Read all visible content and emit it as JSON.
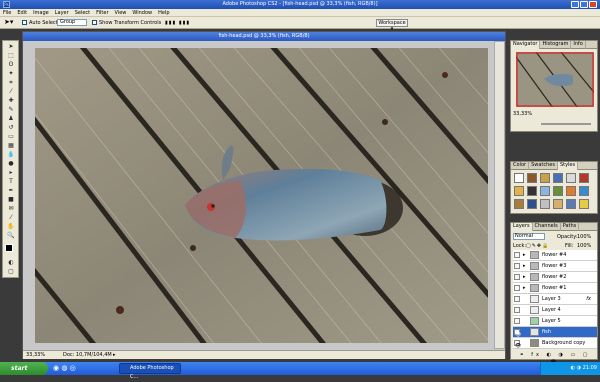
{
  "window": {
    "title": "Adobe Photoshop CS2 - [fish-head.psd @ 33,3% (fish, RGB/8)]"
  },
  "menu": [
    "File",
    "Edit",
    "Image",
    "Layer",
    "Select",
    "Filter",
    "View",
    "Window",
    "Help"
  ],
  "options": {
    "auto_select_label": "Auto Select:",
    "auto_select_value": "Group",
    "transform_label": "Show Transform Controls",
    "workspace_label": "Workspace ▾"
  },
  "document": {
    "title": "fish-head.psd @ 33,3% (fish, RGB/8)",
    "zoom": "33,33%",
    "doc_size": "Doc: 10,7M/104,4M"
  },
  "navigator": {
    "tabs": [
      "Navigator",
      "Histogram",
      "Info"
    ],
    "zoom": "33,33%"
  },
  "color_panel": {
    "tabs": [
      "Color",
      "Swatches",
      "Styles"
    ]
  },
  "layers_panel": {
    "tabs": [
      "Layers",
      "Channels",
      "Paths"
    ],
    "blend_mode": "Normal",
    "opacity_label": "Opacity:",
    "opacity": "100%",
    "lock_label": "Lock:",
    "fill_label": "Fill:",
    "fill": "100%",
    "layers": [
      {
        "name": "flower #4",
        "type": "group",
        "visible": false,
        "selected": false,
        "fx": false
      },
      {
        "name": "flower #3",
        "type": "group",
        "visible": false,
        "selected": false,
        "fx": false
      },
      {
        "name": "flower #2",
        "type": "group",
        "visible": false,
        "selected": false,
        "fx": false
      },
      {
        "name": "flower #1",
        "type": "group",
        "visible": false,
        "selected": false,
        "fx": false
      },
      {
        "name": "Layer 3",
        "type": "layer",
        "visible": false,
        "selected": false,
        "fx": true
      },
      {
        "name": "Layer 4",
        "type": "layer",
        "visible": false,
        "selected": false,
        "fx": false
      },
      {
        "name": "Layer 5",
        "type": "layer",
        "visible": false,
        "selected": false,
        "fx": false
      },
      {
        "name": "fish",
        "type": "layer",
        "visible": true,
        "selected": true,
        "fx": false
      },
      {
        "name": "Background copy",
        "type": "layer",
        "visible": true,
        "selected": false,
        "fx": false
      }
    ]
  },
  "taskbar": {
    "start_label": "start",
    "task_label": "Adobe Photoshop C...",
    "clock": "21:09"
  },
  "colors": {
    "title_blue": "#2b5ac2",
    "taskbar": "#245edb",
    "start_green": "#3a9a3a",
    "selection": "#3169c6",
    "panel_bg": "#ece9d8"
  }
}
